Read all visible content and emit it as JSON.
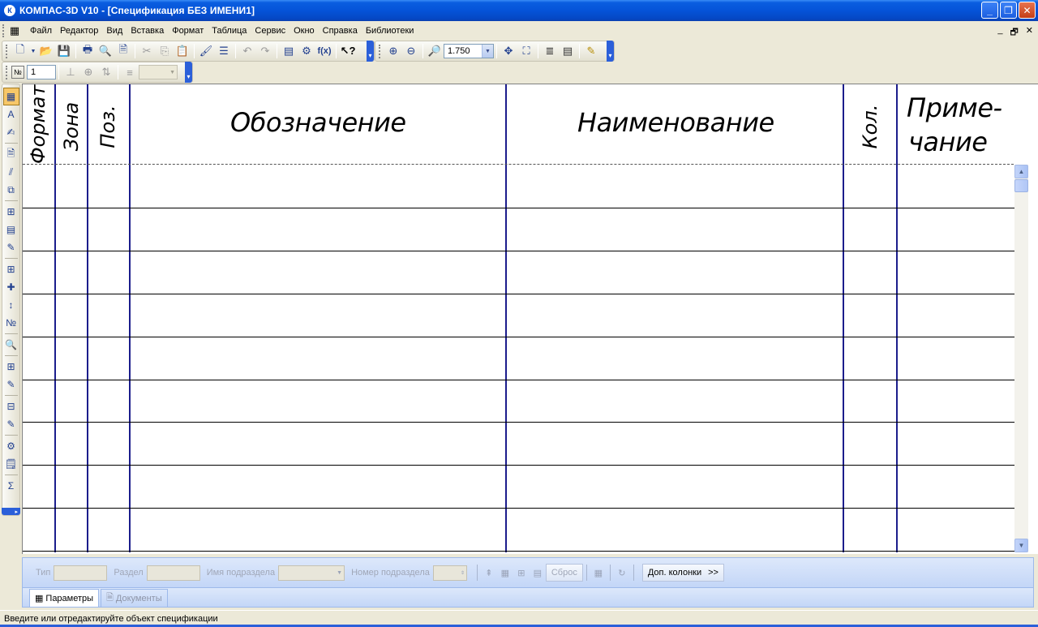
{
  "window": {
    "title": "КОМПАС-3D V10 - [Спецификация БЕЗ ИМЕНИ1]",
    "app_icon": "К",
    "controls": {
      "minimize": "_",
      "maximize": "❐",
      "close": "✕"
    }
  },
  "menu": {
    "items": [
      "Файл",
      "Редактор",
      "Вид",
      "Вставка",
      "Формат",
      "Таблица",
      "Сервис",
      "Окно",
      "Справка",
      "Библиотеки"
    ],
    "mdi_controls": [
      "_",
      "🗗",
      "✕"
    ]
  },
  "toolbar": {
    "zoom_value": "1.750",
    "fx_label": "f(x)"
  },
  "format_toolbar": {
    "number_field": "1",
    "no_label": "№"
  },
  "spec_table": {
    "headers": {
      "format": "Формат",
      "zone": "Зона",
      "pos": "Поз.",
      "designation": "Обозначение",
      "name": "Наименование",
      "qty": "Кол.",
      "note_line1": "Приме-",
      "note_line2": "чание"
    },
    "row_count": 9,
    "line_color": "#1b1d8c"
  },
  "properties_panel": {
    "type_label": "Тип",
    "section_label": "Раздел",
    "subsection_name_label": "Имя подраздела",
    "subsection_number_label": "Номер подраздела",
    "reset_label": "Сброс",
    "extra_columns_label": "Доп. колонки",
    "extra_columns_arrow": ">>"
  },
  "tabs": [
    {
      "label": "Параметры",
      "active": true
    },
    {
      "label": "Документы",
      "active": false
    }
  ],
  "status": {
    "text": "Введите или отредактируйте объект спецификации"
  }
}
